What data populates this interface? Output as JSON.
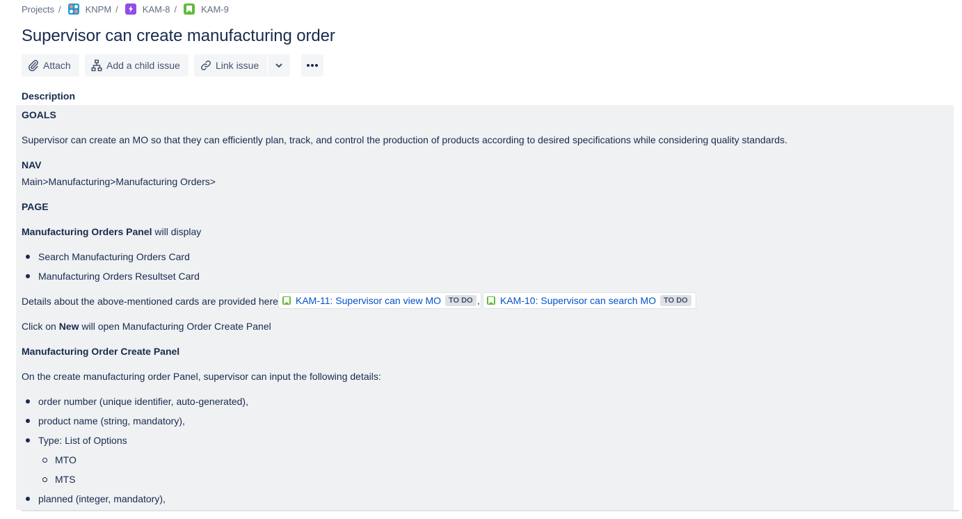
{
  "breadcrumb": {
    "projects": "Projects",
    "project": "KNPM",
    "epic": "KAM-8",
    "issue": "KAM-9",
    "separator": "/"
  },
  "issue": {
    "title": "Supervisor can create manufacturing order"
  },
  "toolbar": {
    "attach": "Attach",
    "add_child": "Add a child issue",
    "link_issue": "Link issue"
  },
  "description": {
    "label": "Description",
    "goals_heading": "GOALS",
    "goals_text": "Supervisor can create an MO so that they can efficiently plan, track, and control the production of products according to desired specifications while considering quality standards.",
    "nav_heading": "NAV",
    "nav_text": "Main>Manufacturing>Manufacturing Orders>",
    "page_heading": "PAGE",
    "panel_bold": "Manufacturing Orders Panel",
    "panel_rest": " will display",
    "panel_items": [
      "Search Manufacturing Orders Card",
      "Manufacturing Orders Resultset Card"
    ],
    "details_text": "Details about the above-mentioned cards are provided here",
    "linked_issues": [
      {
        "key_title": "KAM-11: Supervisor can view MO",
        "status": "TO DO"
      },
      {
        "key_title": "KAM-10: Supervisor can search MO",
        "status": "TO DO"
      }
    ],
    "comma": ",",
    "click_pre": "Click on ",
    "click_bold": "New",
    "click_post": " will open Manufacturing Order Create Panel",
    "create_heading": "Manufacturing Order Create Panel",
    "create_intro": "On the create manufacturing order Panel, supervisor can input the following details:",
    "create_items": [
      "order number (unique identifier, auto-generated),",
      "product name (string, mandatory),",
      "Type: List of Options",
      "planned (integer, mandatory),"
    ],
    "type_options": [
      "MTO",
      "MTS"
    ]
  },
  "colors": {
    "link": "#0052cc",
    "story": "#63ba3c",
    "epic": "#904ee2",
    "desc_bg": "#f0f1f3"
  }
}
